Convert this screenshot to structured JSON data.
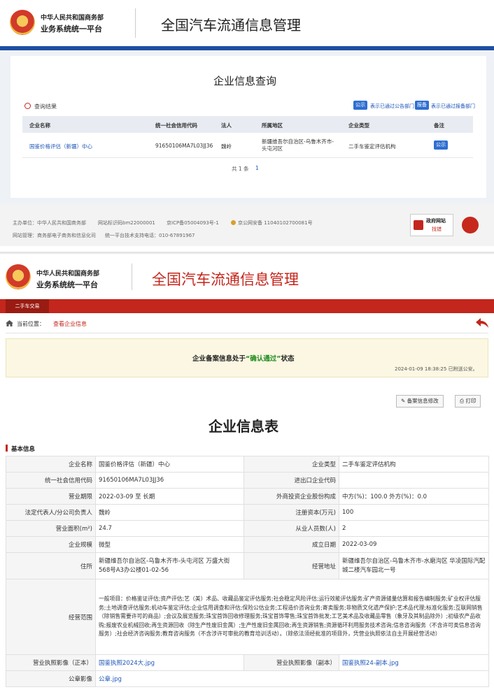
{
  "top": {
    "org_line1": "中华人民共和国商务部",
    "org_line2": "业务系统统一平台",
    "title": "全国汽车流通信息管理"
  },
  "query": {
    "title": "企业信息查询",
    "result_label": "查询结果",
    "btn_public": "公示",
    "btn_public_text": "表示已通过公告部门",
    "btn_report": "报备",
    "btn_report_text": "表示已通过报备部门",
    "columns": [
      "企业名称",
      "统一社会信用代码",
      "法人",
      "所属地区",
      "企业类型",
      "备注"
    ],
    "rows": [
      {
        "name": "国鉴价格评估（新疆）中心",
        "code": "91650106MA7L03JJ36",
        "legal": "魏岭",
        "region": "新疆维吾尔自治区-乌鲁木齐市-头屯河区",
        "type": "二手车鉴定评估机构",
        "note": "公示"
      }
    ],
    "pager_total": "共 1 条",
    "pager_page": "1"
  },
  "footer": {
    "sponsor": "主办单位：中华人民共和国商务部",
    "site_id": "网站标识码bm22000001",
    "icp": "京ICP备05004093号-1",
    "police": "京公网安备 11040102700081号",
    "maintain": "网站管理：商务部电子商务和信息化司",
    "support": "统一平台技术支持电话：010-67891967",
    "gov_site_label": "政府网站",
    "gov_site_sub": "找错"
  },
  "page2": {
    "org_line1": "中华人民共和国商务部",
    "org_line2": "业务系统统一平台",
    "title": "全国汽车流通信息管理",
    "tab": "二手车交易",
    "crumb_label": "当前位置：",
    "crumb_link": "查看企业信息",
    "status_prefix": "企业备案信息处于",
    "status_value": "“确认通过”",
    "status_suffix": "状态",
    "status_time": "2024-01-09 18:38:25 已附送公安。",
    "btn_edit": "备案信息修改",
    "btn_print": "打印",
    "form_title": "企业信息表",
    "section": "基本信息"
  },
  "info": {
    "r1": {
      "l1": "企业名称",
      "v1": "国鉴价格评估（新疆）中心",
      "l2": "企业类型",
      "v2": "二手车鉴定评估机构"
    },
    "r2": {
      "l1": "统一社会信用代码",
      "v1": "91650106MA7L03JJ36",
      "l2": "进出口企业代码",
      "v2": ""
    },
    "r3": {
      "l1": "营业期限",
      "v1": "2022-03-09 至 长期",
      "l2": "外商投资企业股份构成",
      "v2": "中方(%)：100.0  外方(%)：0.0"
    },
    "r4": {
      "l1": "法定代表人/分公司负责人",
      "v1": "魏岭",
      "l2": "注册资本(万元)",
      "v2": "100"
    },
    "r5": {
      "l1": "营业面积(m²)",
      "v1": "24.7",
      "l2": "从业人员数(人)",
      "v2": "2"
    },
    "r6": {
      "l1": "企业规模",
      "v1": "微型",
      "l2": "成立日期",
      "v2": "2022-03-09"
    },
    "r7": {
      "l1": "住所",
      "v1": "新疆维吾尔自治区-乌鲁木齐市-头屯河区 万盛大街568号A3办公楼01-02-56",
      "l2": "经营地址",
      "v2": "新疆维吾尔自治区-乌鲁木齐市-水磨沟区 华凌国际汽配城二楼汽车园北一号"
    },
    "r8": {
      "l1": "经营范围",
      "v1": "一般项目：价格鉴证评估;资产评估;艺（美）术品、收藏品鉴定评估服务;社会稳定风险评估;运行效能评估服务;矿产资源储量估算和报告编制服务;矿业权评估服务;土地调查评估服务;机动车鉴定评估;企业信用调查和评估;保险公估业务;工程造价咨询业务;寄卖服务;非物质文化遗产保护;艺术品代理;标准化服务;互联网销售（除销售需要许可的商品）;会议及展览服务;珠宝首饰回收修理服务;珠宝首饰零售;珠宝首饰批发;工艺美术品及收藏品零售（象牙及其制品除外）;初级农产品收购;报废农业机械回收;再生资源回收（除生产性废旧金属）;生产性废旧金属回收;再生资源销售;资源循环利用服务技术咨询;信息咨询服务（不含许可类信息咨询服务）;社会经济咨询服务;教育咨询服务（不含涉许可审批的教育培训活动）。（除依法须经批准的项目外，凭营业执照依法自主开展经营活动）"
    },
    "r9": {
      "l1": "营业执照影像（正本）",
      "v1": "国鉴执照2024大.jpg",
      "l2": "营业执照影像（副本）",
      "v2": "国鉴执照24-副本.jpg"
    },
    "r10": {
      "l1": "公章影像",
      "v1": "公章.jpg"
    }
  }
}
